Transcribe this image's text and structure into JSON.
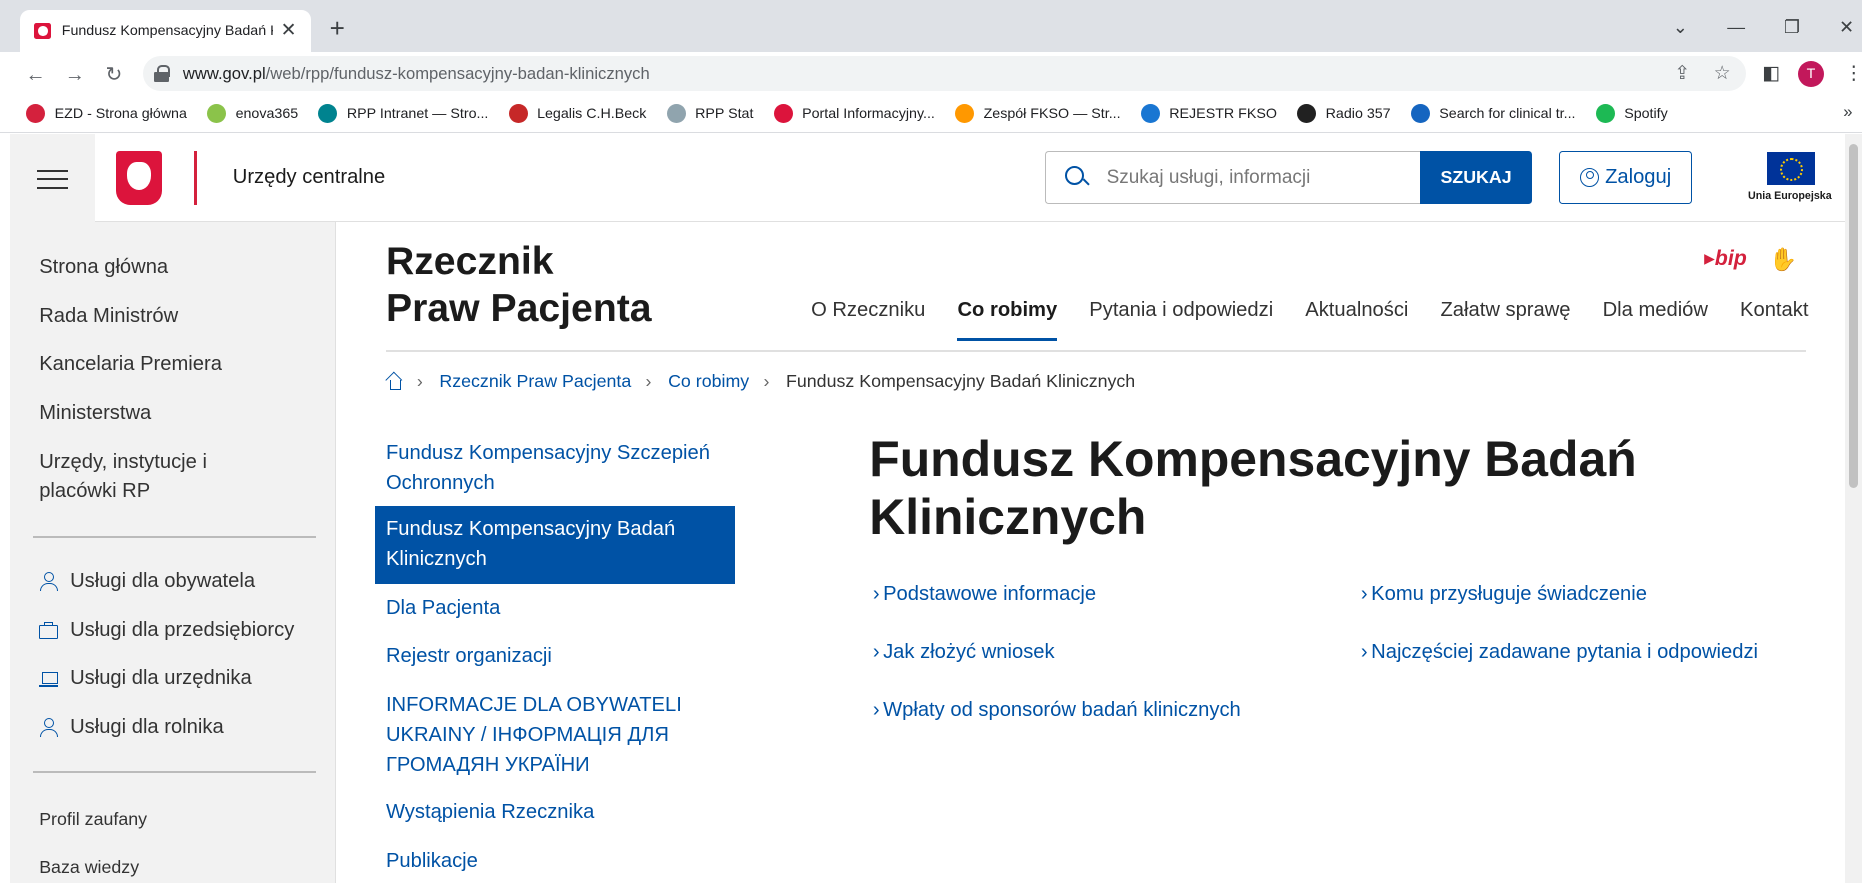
{
  "browser": {
    "tab_title": "Fundusz Kompensacyjny Badań Kl",
    "url_host": "www.gov.pl",
    "url_path": "/web/rpp/fundusz-kompensacyjny-badan-klinicznych",
    "profile_letter": "T",
    "bookmarks": [
      {
        "label": "EZD - Strona główna",
        "color": "#d4213d"
      },
      {
        "label": "enova365",
        "color": "#8bc34a"
      },
      {
        "label": "RPP Intranet — Stro...",
        "color": "#00838f"
      },
      {
        "label": "Legalis C.H.Beck",
        "color": "#c62828"
      },
      {
        "label": "RPP Stat",
        "color": "#90a4ae"
      },
      {
        "label": "Portal Informacyjny...",
        "color": "#dc143c"
      },
      {
        "label": "Zespół FKSO — Str...",
        "color": "#ff9800"
      },
      {
        "label": "REJESTR FKSO",
        "color": "#1976d2"
      },
      {
        "label": "Radio 357",
        "color": "#212121"
      },
      {
        "label": "Search for clinical tr...",
        "color": "#1565c0"
      },
      {
        "label": "Spotify",
        "color": "#1db954"
      }
    ]
  },
  "header": {
    "site_name": "Urzędy centralne",
    "search_placeholder": "Szukaj usługi, informacji",
    "search_button": "SZUKAJ",
    "login_button": "Zaloguj",
    "eu_label": "Unia Europejska"
  },
  "sidebar": {
    "links": [
      "Strona główna",
      "Rada Ministrów",
      "Kancelaria Premiera",
      "Ministerstwa",
      "Urzędy, instytucje i placówki RP"
    ],
    "services": [
      "Usługi dla obywatela",
      "Usługi dla przedsiębiorcy",
      "Usługi dla urzędnika",
      "Usługi dla rolnika"
    ],
    "extra": [
      "Profil zaufany",
      "Baza wiedzy"
    ]
  },
  "org": {
    "title_line1": "Rzecznik",
    "title_line2": "Praw Pacjenta",
    "bip": "bip",
    "nav": [
      "O Rzeczniku",
      "Co robimy",
      "Pytania i odpowiedzi",
      "Aktualności",
      "Załatw sprawę",
      "Dla mediów",
      "Kontakt"
    ]
  },
  "breadcrumb": {
    "items": [
      "Rzecznik Praw Pacjenta",
      "Co robimy"
    ],
    "current": "Fundusz Kompensacyjny Badań Klinicznych"
  },
  "subnav": {
    "items": [
      "Fundusz Kompensacyjny Szczepień Ochronnych",
      "Fundusz Kompensacyjny Badań Klinicznych",
      "Dla Pacjenta",
      "Rejestr organizacji",
      "INFORMACJE DLA OBYWATELI UKRAINY / ІНФОРМАЦІЯ ДЛЯ ГРОМАДЯН УКРАЇНИ",
      "Wystąpienia Rzecznika",
      "Publikacje"
    ]
  },
  "main": {
    "title": "Fundusz Kompensacyjny Badań Klinicznych",
    "links": [
      "Podstawowe informacje",
      "Komu przysługuje świadczenie",
      "Jak złożyć wniosek",
      "Najczęściej zadawane pytania i odpowiedzi",
      "Wpłaty od sponsorów badań klinicznych"
    ]
  }
}
